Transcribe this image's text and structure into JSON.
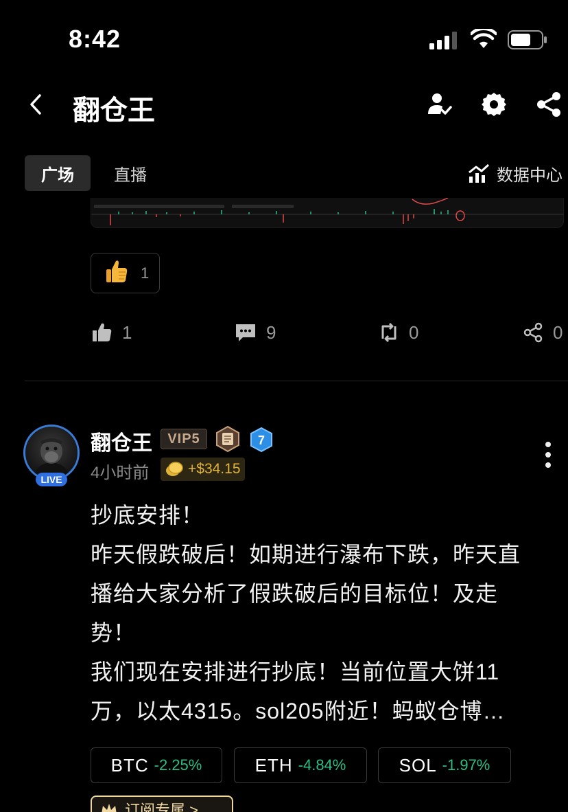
{
  "status_bar": {
    "time": "8:42"
  },
  "header": {
    "title": "翻仓王"
  },
  "tabs": [
    {
      "label": "广场",
      "active": true
    },
    {
      "label": "直播",
      "active": false
    }
  ],
  "data_center": {
    "label": "数据中心"
  },
  "prev_post": {
    "reaction": {
      "emoji": "👍",
      "count": "1"
    },
    "actions": {
      "like": "1",
      "comment": "9",
      "repost": "0",
      "share": "0"
    }
  },
  "post": {
    "author": "翻仓王",
    "vip": "VIP5",
    "level": "7",
    "live_label": "LIVE",
    "time": "4小时前",
    "pnl": "+$34.15",
    "body": [
      "抄底安排！",
      "昨天假跌破后！如期进行瀑布下跌，昨天直",
      "播给大家分析了假跌破后的目标位！及走",
      "势！",
      "我们现在安排进行抄底！当前位置大饼11",
      "万，以太4315。sol205附近！蚂蚁仓博…"
    ],
    "tickers": [
      {
        "symbol": "BTC",
        "change": "-2.25%"
      },
      {
        "symbol": "ETH",
        "change": "-4.84%"
      },
      {
        "symbol": "SOL",
        "change": "-1.97%"
      }
    ],
    "partial_chip_label": "订阅专属 >"
  },
  "colors": {
    "background": "#000000",
    "positive": "#2ebd85",
    "live": "#2f6fe0",
    "gold": "#e2b43a"
  }
}
